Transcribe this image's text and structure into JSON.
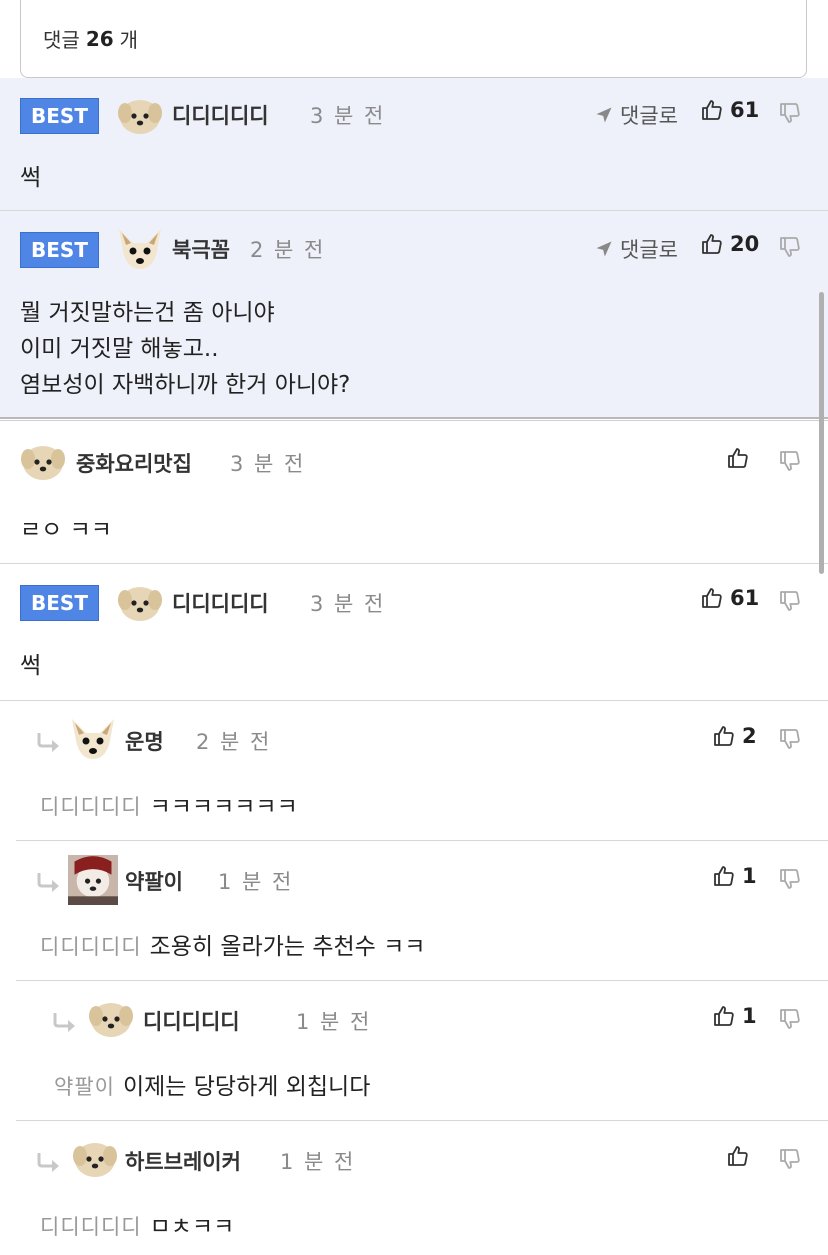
{
  "header": {
    "count_prefix": "댓글",
    "count": "26",
    "count_suffix": "개"
  },
  "labels": {
    "best": "BEST",
    "reply_link": "댓글로"
  },
  "comments": [
    {
      "best": true,
      "nick": "디디디디디",
      "time": "3 분 전",
      "likes": "61",
      "text": "썩",
      "show_reply_link": true
    },
    {
      "best": true,
      "nick": "북극꼼",
      "time": "2 분 전",
      "likes": "20",
      "text": "뭘 거짓말하는건 좀 아니야\n이미 거짓말 해놓고..\n염보성이 자백하니까 한거 아니야?",
      "show_reply_link": true
    },
    {
      "best": false,
      "nick": "중화요리맛집",
      "time": "3 분 전",
      "likes": "",
      "text": "ㄹㅇ ㅋㅋ"
    },
    {
      "best": true,
      "nick": "디디디디디",
      "time": "3 분 전",
      "likes": "61",
      "text": "썩"
    },
    {
      "reply": true,
      "nick": "운명",
      "time": "2 분 전",
      "likes": "2",
      "mention": "디디디디디",
      "text": "ㅋㅋㅋㅋㅋㅋㅋ"
    },
    {
      "reply": true,
      "nick": "약팔이",
      "time": "1 분 전",
      "likes": "1",
      "mention": "디디디디디",
      "text": "조용히 올라가는 추천수 ㅋㅋ"
    },
    {
      "reply": true,
      "nick": "디디디디디",
      "time": "1 분 전",
      "likes": "1",
      "mention": "약팔이",
      "text": "이제는 당당하게 외칩니다"
    },
    {
      "reply": true,
      "nick": "하트브레이커",
      "time": "1 분 전",
      "likes": "",
      "mention": "디디디디디",
      "text": "ㅁㅊㅋㅋ"
    }
  ],
  "icons": {
    "thumbs_up": "thumbs-up-icon",
    "thumbs_down": "thumbs-down-icon",
    "reply_arrow": "reply-arrow-icon",
    "send": "send-arrow-icon"
  },
  "colors": {
    "best_badge": "#4f86e6",
    "best_row_bg": "#eef1fa",
    "muted_text": "#8a8a8a"
  }
}
